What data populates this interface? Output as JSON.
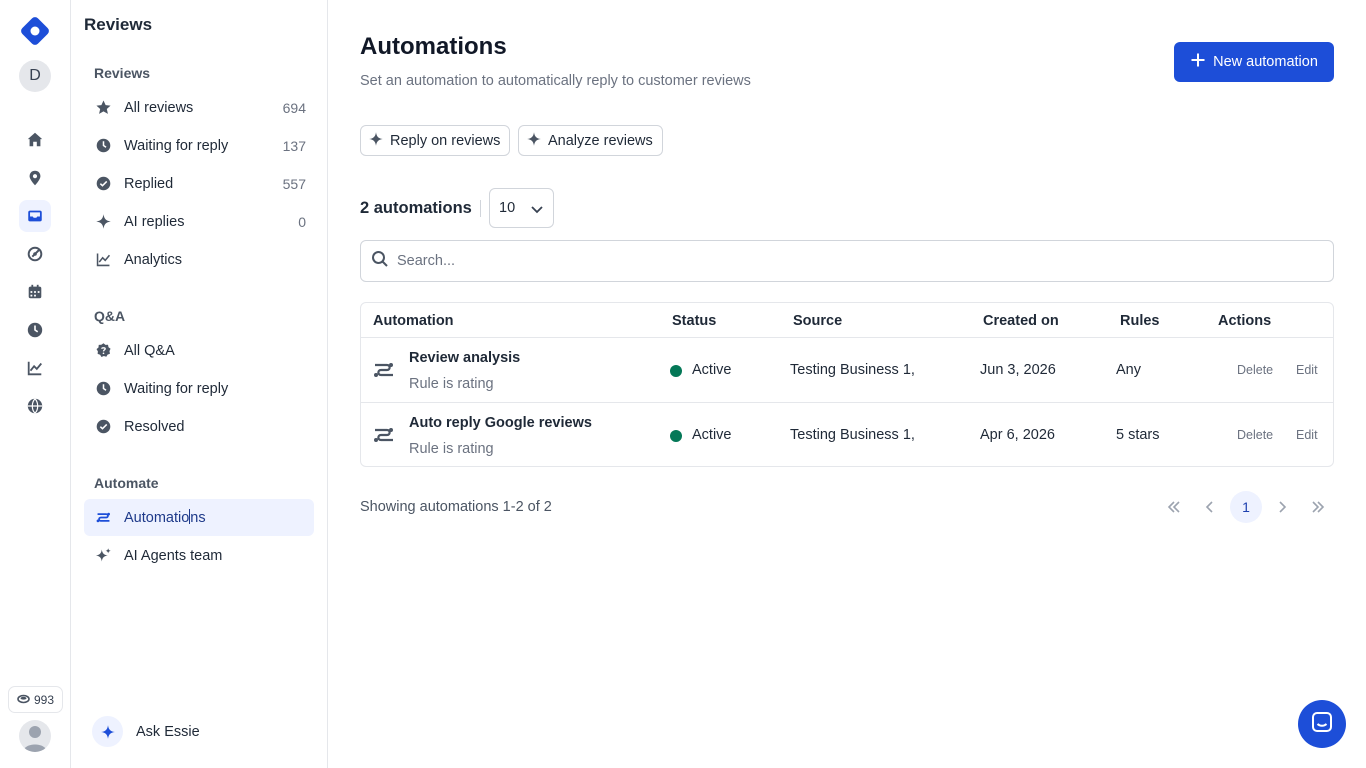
{
  "colors": {
    "accent": "#1d4ed8",
    "active_bg": "#eef2ff",
    "status_active": "#047857"
  },
  "rail": {
    "workspace_initial": "D",
    "nav_icons": [
      "home-icon",
      "location-pin-icon",
      "inbox-icon",
      "tag-icon",
      "calendar-icon",
      "clock-icon",
      "chart-icon",
      "globe-icon"
    ],
    "active_icon": "inbox-icon",
    "credits": "993"
  },
  "sidebar": {
    "title": "Reviews",
    "sections": {
      "reviews": "Reviews",
      "qa": "Q&A",
      "automate": "Automate"
    },
    "reviews_items": [
      {
        "label": "All reviews",
        "count": "694",
        "icon": "star-icon"
      },
      {
        "label": "Waiting for reply",
        "count": "137",
        "icon": "clock-icon"
      },
      {
        "label": "Replied",
        "count": "557",
        "icon": "check-circle-icon"
      },
      {
        "label": "AI replies",
        "count": "0",
        "icon": "sparkle-icon"
      },
      {
        "label": "Analytics",
        "count": "",
        "icon": "chart-icon"
      }
    ],
    "qa_items": [
      {
        "label": "All Q&A",
        "icon": "question-badge-icon"
      },
      {
        "label": "Waiting for reply",
        "icon": "clock-icon"
      },
      {
        "label": "Resolved",
        "icon": "check-circle-icon"
      }
    ],
    "automate_items": [
      {
        "label_a": "Automatio",
        "label_b": "ns",
        "icon": "automation-icon",
        "active": true
      },
      {
        "label": "AI Agents team",
        "icon": "sparkles-icon"
      }
    ],
    "ask": "Ask Essie"
  },
  "main": {
    "title": "Automations",
    "subtitle": "Set an automation to automatically reply to customer reviews",
    "new_button": "New automation",
    "chips": [
      "Reply on reviews",
      "Analyze reviews"
    ],
    "count_label": "2 automations",
    "per_page": "10",
    "search_placeholder": "Search...",
    "columns": [
      "Automation",
      "Status",
      "Source",
      "Created on",
      "Rules",
      "Actions"
    ],
    "rows": [
      {
        "name": "Review analysis",
        "sub": "Rule is rating",
        "status": "Active",
        "source": "Testing Business 1,",
        "created": "Jun 3, 2026",
        "rules": "Any",
        "delete": "Delete",
        "edit": "Edit"
      },
      {
        "name": "Auto reply Google reviews",
        "sub": "Rule is rating",
        "status": "Active",
        "source": "Testing Business 1,",
        "created": "Apr 6, 2026",
        "rules": "5 stars",
        "delete": "Delete",
        "edit": "Edit"
      }
    ],
    "showing": "Showing automations 1-2 of 2",
    "current_page": "1"
  }
}
